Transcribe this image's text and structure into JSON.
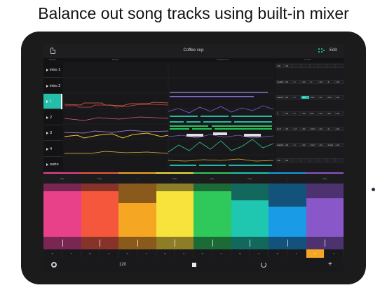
{
  "headline": "Balance out song tracks using built-in mixer",
  "app": {
    "song_title": "Coffee cup",
    "edit_label": "Edit",
    "icons": {
      "document": "document-icon",
      "grid": "dots-grid-icon",
      "settings": "gear-icon",
      "stop": "stop-icon",
      "loop": "loop-icon",
      "add": "plus-icon"
    }
  },
  "column_headers": [
    "Section",
    "Melody",
    "Arrangement",
    "Chords"
  ],
  "tracks": [
    {
      "label": "intro 1",
      "active": false
    },
    {
      "label": "intro 2",
      "active": false
    },
    {
      "label": "1",
      "active": true
    },
    {
      "label": "2",
      "active": false
    },
    {
      "label": "3",
      "active": false
    },
    {
      "label": "4",
      "active": false
    },
    {
      "label": "outro",
      "active": false
    }
  ],
  "chords": [
    [
      "C/E",
      "4/4",
      "",
      "",
      "",
      "",
      "",
      ""
    ],
    [
      "Cadd9",
      "4/4",
      "G",
      "4/4",
      "F",
      "4/4",
      "F",
      "4/4"
    ],
    [
      "Fadd9",
      "4/4",
      "G",
      "4/4",
      "Dm7",
      "4/4",
      "Am7",
      "4/4"
    ],
    [
      "F",
      "4/4",
      "G",
      "4/4",
      "Em",
      "4/4",
      "Am",
      "4/4"
    ],
    [
      "Dm7",
      "4/4",
      "G7",
      "4/4",
      "Dm7",
      "4/4",
      "G",
      "4/4"
    ],
    [
      "Fadd9",
      "4/4",
      "G",
      "4/4",
      "Dm7",
      "4/4",
      "Am/E",
      "4/4"
    ],
    [
      "C/E",
      "4/4",
      "",
      "",
      "",
      "",
      "",
      ""
    ]
  ],
  "play_buttons": [
    "Play",
    "Play",
    "—",
    "Play",
    "Play",
    "Play",
    "—",
    "Play"
  ],
  "mixer_channels": [
    {
      "color": "#e8418a",
      "dark": "#7a2653",
      "level": 0.86
    },
    {
      "color": "#f5573c",
      "dark": "#873329",
      "level": 0.86
    },
    {
      "color": "#f5a623",
      "dark": "#8a5a1c",
      "level": 0.63
    },
    {
      "color": "#f7e33b",
      "dark": "#8c7d26",
      "level": 0.86
    },
    {
      "color": "#2ec95a",
      "dark": "#1c6b36",
      "level": 0.86
    },
    {
      "color": "#1fc6b0",
      "dark": "#13685e",
      "level": 0.68
    },
    {
      "color": "#1a9be6",
      "dark": "#13527a",
      "level": 0.57
    },
    {
      "color": "#8a57c9",
      "dark": "#4d3270",
      "level": 0.72
    }
  ],
  "mute_solo": [
    "M",
    "S",
    "M",
    "S",
    "M",
    "S",
    "M",
    "S",
    "M",
    "S",
    "M",
    "S",
    "M",
    "S",
    "M",
    "S"
  ],
  "solo_active_index": 14,
  "tempo": "120"
}
